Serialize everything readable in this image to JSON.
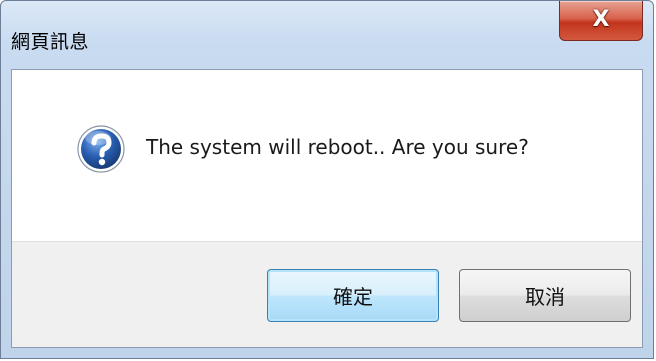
{
  "window": {
    "title": "網頁訊息",
    "close_label": "X"
  },
  "dialog": {
    "icon": "question-icon",
    "message": "The system will reboot.. Are you sure?"
  },
  "buttons": {
    "ok_label": "確定",
    "cancel_label": "取消"
  },
  "colors": {
    "titlebar": "#c9dbf0",
    "close_button": "#c2341c",
    "question_icon": "#2a5fb3",
    "footer": "#f0f0f0",
    "default_button_border": "#3c7fb1"
  }
}
